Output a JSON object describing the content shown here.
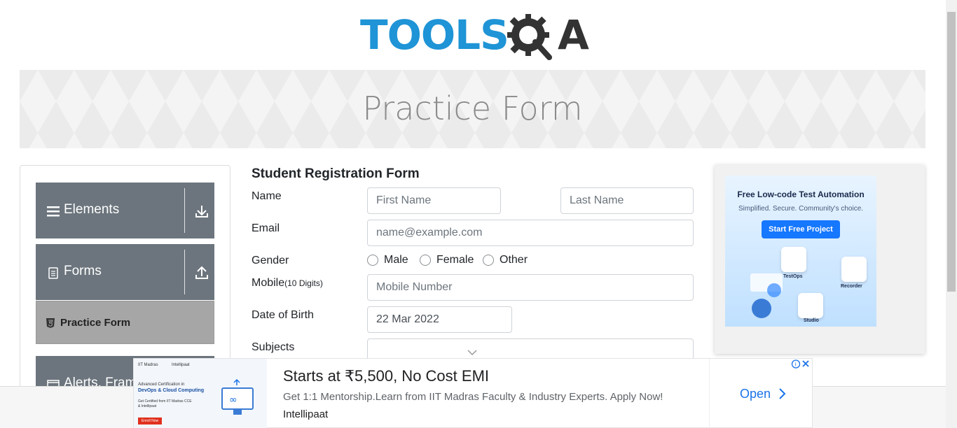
{
  "header": {
    "logo_text": "TOOLS",
    "logo_q": "Q",
    "logo_a": "A"
  },
  "banner": {
    "title": "Practice Form"
  },
  "sidebar": {
    "groups": [
      {
        "label": "Elements",
        "icon": "hamburger-icon",
        "arrow": "download-icon"
      },
      {
        "label": "Forms",
        "icon": "document-icon",
        "arrow": "upload-icon"
      },
      {
        "label": "Alerts, Frame & Windows",
        "icon": "window-icon"
      }
    ],
    "active_item": {
      "label": "Practice Form",
      "icon": "html5-icon"
    }
  },
  "form": {
    "title": "Student Registration Form",
    "name_label": "Name",
    "first_name_placeholder": "First Name",
    "last_name_placeholder": "Last Name",
    "email_label": "Email",
    "email_placeholder": "name@example.com",
    "gender_label": "Gender",
    "gender_options": [
      "Male",
      "Female",
      "Other"
    ],
    "mobile_label": "Mobile",
    "mobile_hint": "(10 Digits)",
    "mobile_placeholder": "Mobile Number",
    "dob_label": "Date of Birth",
    "dob_value": "22 Mar 2022",
    "subjects_label": "Subjects"
  },
  "side_ad": {
    "title": "Free Low-code Test Automation",
    "subtitle": "Simplified. Secure. Community's choice.",
    "button": "Start Free Project",
    "tiles": [
      "TestOps",
      "Recorder",
      "Studio"
    ]
  },
  "bottom_ad": {
    "headline": "Starts at ₹5,500, No Cost EMI",
    "description": "Get 1:1 Mentorship.Learn from IIT Madras Faculty & Industry Experts. Apply Now!",
    "advertiser": "Intellipaat",
    "open_label": "Open",
    "image_lines": [
      "IIT Madras",
      "Intellipaat",
      "Advanced Certification in",
      "DevOps & Cloud Computing",
      "Get Certified from IIT Madras CCE",
      "& Intellipaat",
      "Enroll Now"
    ]
  },
  "colors": {
    "logo_blue": "#1f94d6",
    "sidebar_group": "#6c757d",
    "sidebar_active": "#a6a6a6",
    "link_blue": "#1a73e8"
  }
}
